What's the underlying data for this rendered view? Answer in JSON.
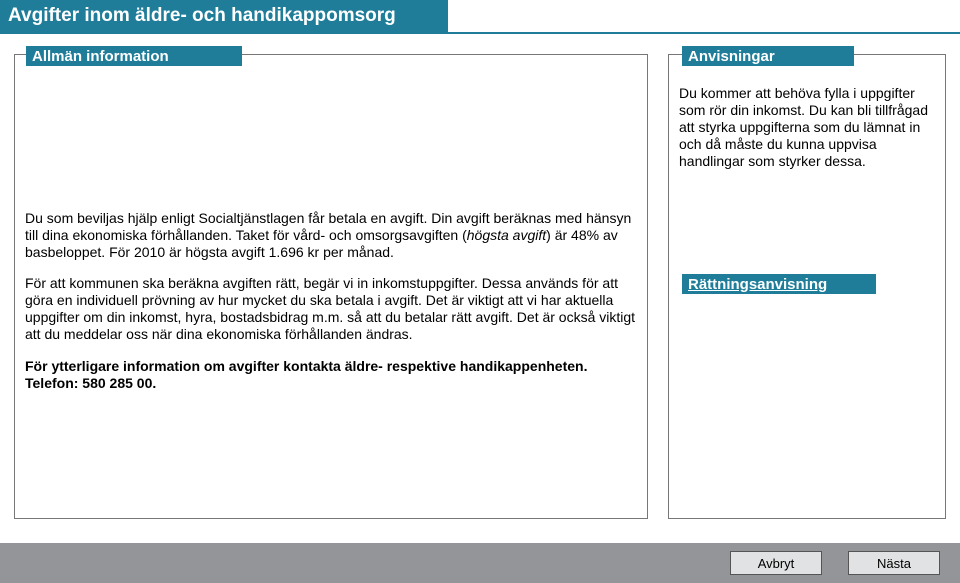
{
  "title": "Avgifter inom äldre- och handikappomsorg",
  "sections": {
    "info_label": "Allmän information",
    "anvis_label": "Anvisningar",
    "correction_label": "Rättningsanvisning"
  },
  "sidebar_text": "Du kommer att behöva fylla i uppgifter som rör din inkomst. Du kan bli tillfrågad att styrka uppgifterna som du lämnat in och då måste du kunna uppvisa handlingar som styrker dessa.",
  "main": {
    "p1a": "Du som beviljas hjälp enligt Socialtjänstlagen får betala en avgift. Din avgift beräknas med hänsyn till dina ekonomiska förhållanden. Taket för vård- och omsorgsavgiften (",
    "p1_italic": "högsta avgift",
    "p1b": ") är 48% av basbeloppet. För 2010 är högsta avgift 1.696 kr per månad.",
    "p2": "För att kommunen ska beräkna avgiften rätt, begär vi in inkomstuppgifter. Dessa används för att göra en individuell prövning av hur mycket du ska betala i avgift. Det är viktigt att vi har aktuella uppgifter om din inkomst, hyra, bostadsbidrag m.m. så att du betalar rätt avgift. Det är också viktigt att du meddelar oss när dina ekonomiska förhållanden ändras.",
    "p3a": "För ytterligare information om avgifter kontakta äldre- respektive handikappenheten.",
    "p3b": "Telefon: 580 285 00."
  },
  "buttons": {
    "cancel": "Avbryt",
    "next": "Nästa"
  }
}
